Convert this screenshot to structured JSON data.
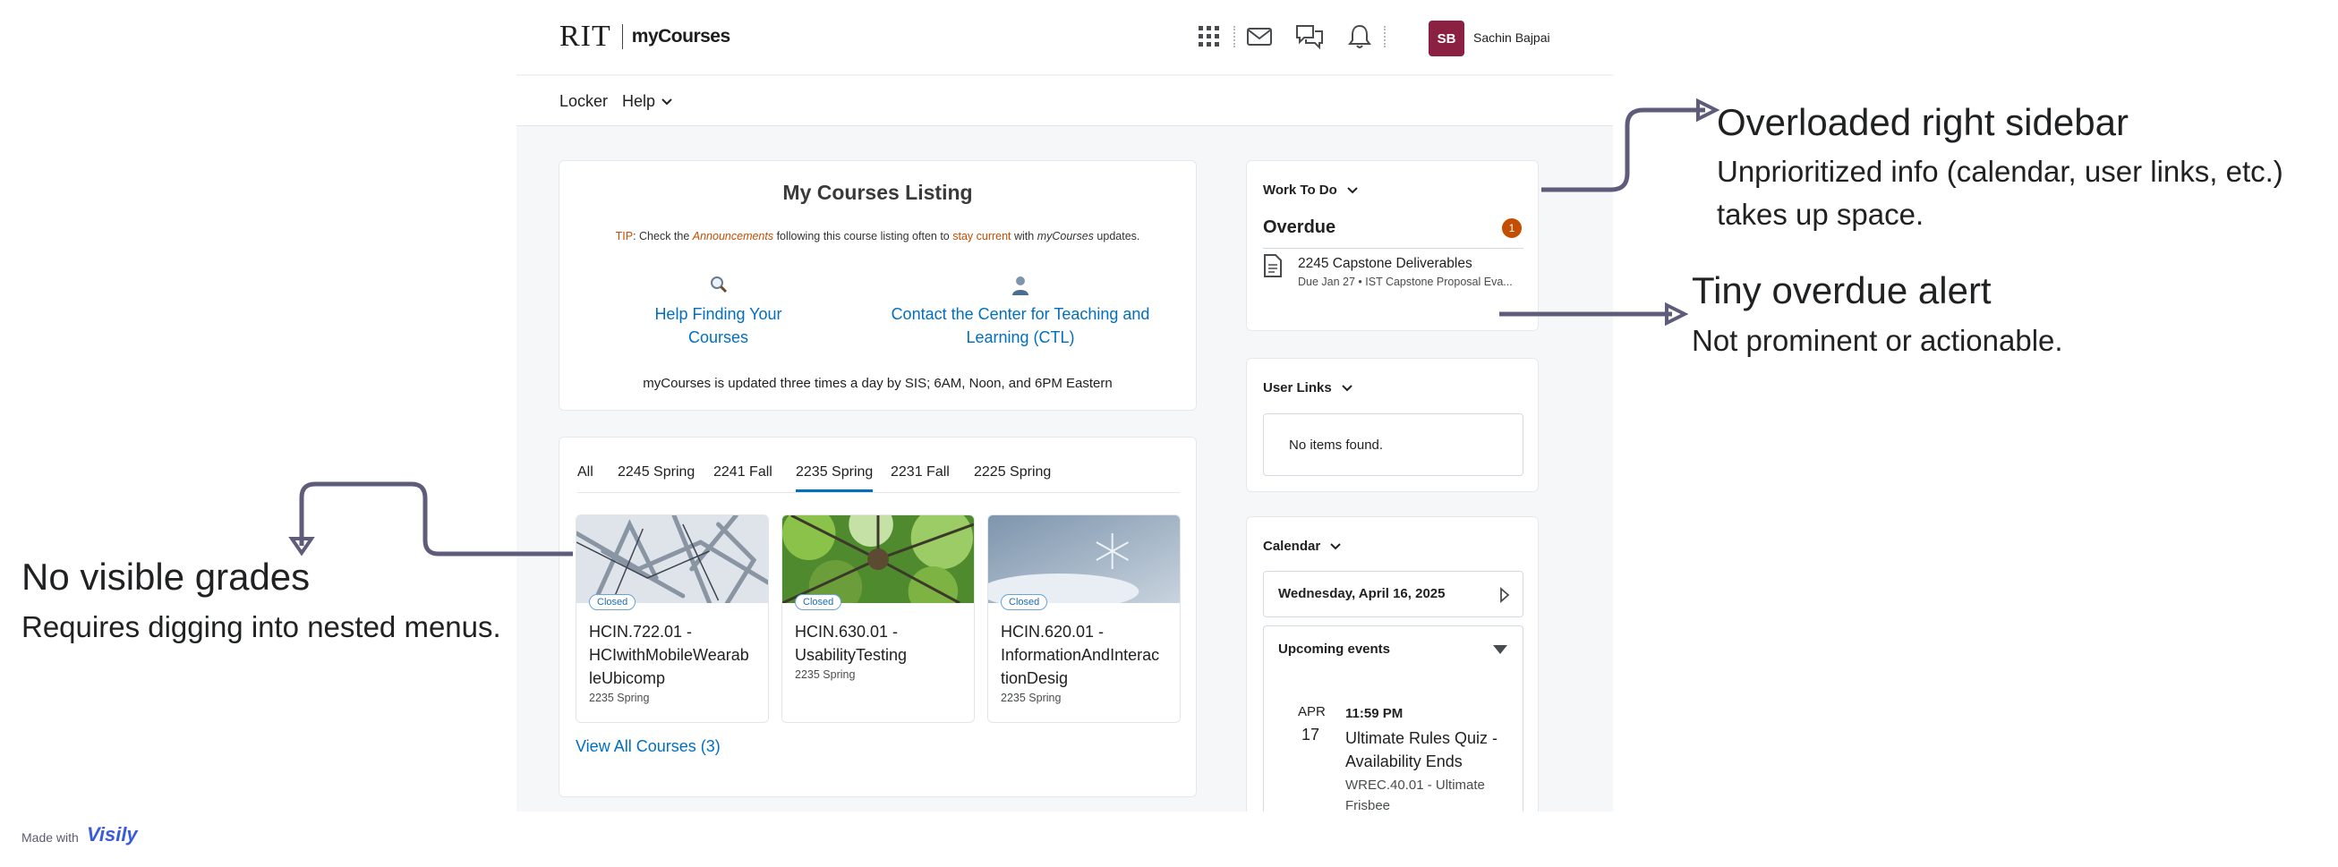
{
  "header": {
    "logo_rit": "RIT",
    "logo_app": "myCourses",
    "user_initials": "SB",
    "user_name": "Sachin Bajpai",
    "icons": [
      "grid-icon",
      "mail-icon",
      "chat-icon",
      "bell-icon"
    ]
  },
  "nav": {
    "items": [
      {
        "label": "Locker"
      },
      {
        "label": "Help"
      }
    ]
  },
  "listing": {
    "title": "My Courses Listing",
    "tip_prefix": "TIP",
    "tip_a": ": Check the ",
    "tip_announcements": "Announcements",
    "tip_b": " following this course listing often to ",
    "tip_stay": "stay current",
    "tip_c": " with ",
    "tip_mycourses": "myCourses",
    "tip_d": " updates.",
    "link1": "Help Finding Your Courses",
    "link2_line1": "Contact the Center for Teaching and",
    "link2_line2": "Learning (CTL)",
    "updated": "myCourses is updated three times a day by SIS; 6AM, Noon, and 6PM Eastern"
  },
  "courses": {
    "tabs": [
      {
        "label": "All"
      },
      {
        "label": "2245 Spring"
      },
      {
        "label": "2241 Fall"
      },
      {
        "label": "2235 Spring"
      },
      {
        "label": "2231 Fall"
      },
      {
        "label": "2225 Spring"
      }
    ],
    "active_tab": "2235 Spring",
    "cards": [
      {
        "badge": "Closed",
        "code_lines": [
          "HCIN.722.01 -",
          "HCIwithMobileWearab",
          "leUbicomp"
        ],
        "term": "2235 Spring"
      },
      {
        "badge": "Closed",
        "code_lines": [
          "HCIN.630.01 -",
          "UsabilityTesting"
        ],
        "term": "2235 Spring"
      },
      {
        "badge": "Closed",
        "code_lines": [
          "HCIN.620.01 -",
          "InformationAndInterac",
          "tionDesig"
        ],
        "term": "2235 Spring"
      }
    ],
    "view_all": "View All Courses (3)"
  },
  "work_to_do": {
    "title": "Work To Do",
    "overdue_label": "Overdue",
    "overdue_count": "1",
    "item_title": "2245 Capstone Deliverables",
    "item_sub": "Due Jan 27 • IST Capstone Proposal Eva..."
  },
  "user_links": {
    "title": "User Links",
    "empty": "No items found."
  },
  "calendar": {
    "title": "Calendar",
    "date": "Wednesday, April 16, 2025",
    "upcoming": "Upcoming events",
    "event_month": "APR",
    "event_day": "17",
    "event_time": "11:59 PM",
    "event_title_1": "Ultimate Rules Quiz -",
    "event_title_2": "Availability Ends",
    "event_course_1": "WREC.40.01 - Ultimate",
    "event_course_2": "Frisbee"
  },
  "annotations": {
    "sidebar_heading": "Overloaded right sidebar",
    "sidebar_line1": "Unprioritized info (calendar, user links, etc.)",
    "sidebar_line2": "takes up space.",
    "overdue_heading": "Tiny overdue alert",
    "overdue_line": "Not prominent or actionable.",
    "grades_heading": "No visible grades",
    "grades_line": "Requires digging into nested menus."
  },
  "footer": {
    "made_with": "Made with",
    "brand": "Visily"
  },
  "colors": {
    "accent": "#006fbf",
    "warning": "#c34d00",
    "avatar": "#8a2143",
    "arrow": "#5e5c7a"
  }
}
